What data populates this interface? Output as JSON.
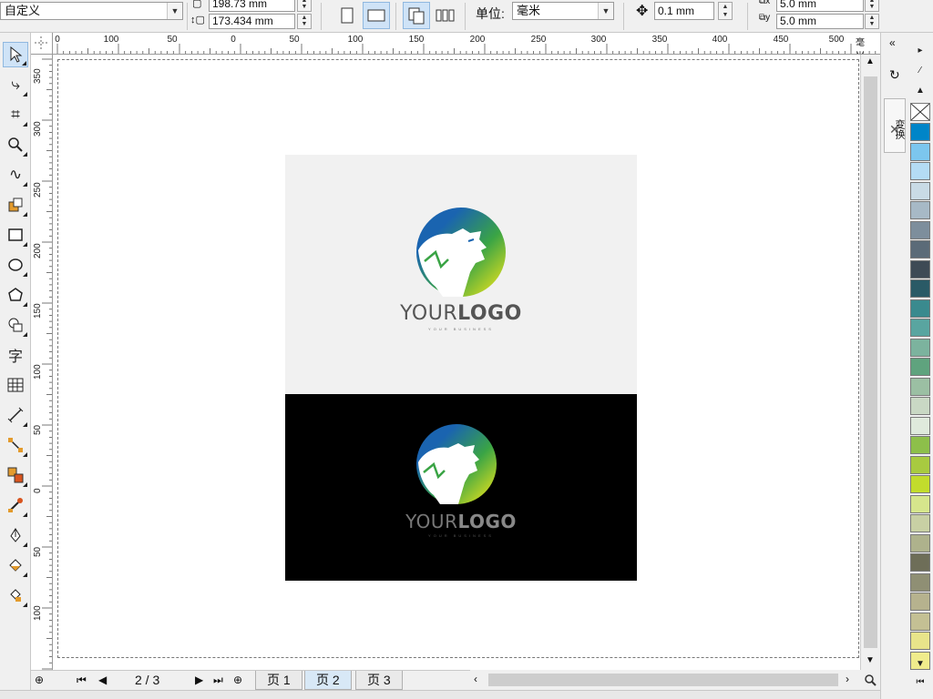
{
  "propbar": {
    "preset": "自定义",
    "width": "198.73 mm",
    "height": "173.434 mm",
    "units_label": "单位:",
    "units_value": "毫米",
    "nudge": "0.1 mm",
    "dup_x": "5.0 mm",
    "dup_y": "5.0 mm"
  },
  "ruler": {
    "unit": "毫米",
    "h_labels": [
      "0",
      "100",
      "50",
      "0",
      "50",
      "100",
      "150",
      "200",
      "250",
      "300",
      "350",
      "400",
      "450",
      "500"
    ],
    "v_labels": [
      "350",
      "300",
      "250",
      "200",
      "150",
      "100",
      "50",
      "0",
      "50",
      "100"
    ]
  },
  "artwork": {
    "logo_word1": "YOUR",
    "logo_word2": "LOGO",
    "tagline": "YOUR BUSINESS",
    "colors": {
      "blue": "#1a64b0",
      "green": "#3aa445",
      "yellow": "#e8e21c",
      "light_bg": "#f1f1f1",
      "dark_bg": "#000000"
    }
  },
  "pagenav": {
    "counter": "2 / 3",
    "tabs": [
      "页 1",
      "页 2",
      "页 3"
    ],
    "active_tab": 1
  },
  "docker": {
    "tab_label": "变换"
  },
  "palette": {
    "colors": [
      "#0085c8",
      "#7cc6ee",
      "#b4dcf4",
      "#c9dbe6",
      "#a7b9c6",
      "#7d8e9c",
      "#5b6b78",
      "#3e4a55",
      "#2a5a66",
      "#3a8a8e",
      "#59a5a0",
      "#7cb39e",
      "#5fa37e",
      "#9bbfa3",
      "#c9d8c4",
      "#dfeadc",
      "#8dbf4a",
      "#a8ca40",
      "#c2dc2c",
      "#d6e68c",
      "#c8d0a4",
      "#aeb28c",
      "#6e6e58",
      "#8f8f74",
      "#b6b28e",
      "#c4c094",
      "#e8e48a",
      "#f0ec8c"
    ]
  }
}
